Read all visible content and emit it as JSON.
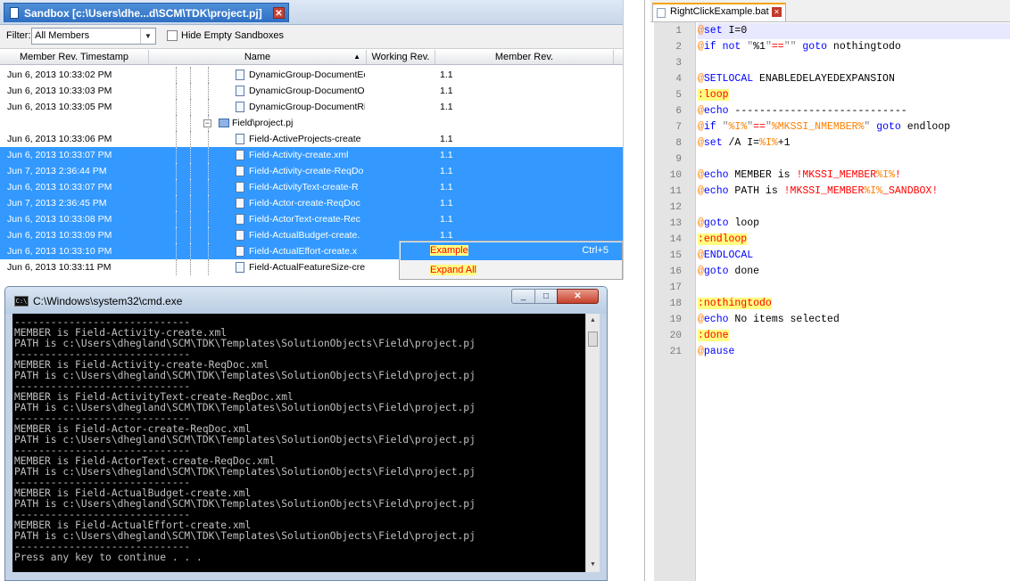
{
  "sandbox": {
    "title": "Sandbox [c:\\Users\\dhe...d\\SCM\\TDK\\project.pj]",
    "filter_label": "Filter:",
    "filter_value": "All Members",
    "hide_empty_label": "Hide Empty Sandboxes",
    "hide_empty_checked": false,
    "columns": {
      "timestamp": "Member Rev. Timestamp",
      "name": "Name",
      "working_rev": "Working Rev.",
      "member_rev": "Member Rev."
    },
    "rows": [
      {
        "ts": "Jun 6, 2013 10:33:02 PM",
        "name": "DynamicGroup-DocumentEc",
        "rev": "1.1",
        "selected": false
      },
      {
        "ts": "Jun 6, 2013 10:33:03 PM",
        "name": "DynamicGroup-DocumentO",
        "rev": "1.1",
        "selected": false
      },
      {
        "ts": "Jun 6, 2013 10:33:05 PM",
        "name": "DynamicGroup-DocumentRi",
        "rev": "1.1",
        "selected": false
      },
      {
        "ts": "",
        "name": "Field\\project.pj",
        "rev": "",
        "selected": false,
        "project": true
      },
      {
        "ts": "Jun 6, 2013 10:33:06 PM",
        "name": "Field-ActiveProjects-create",
        "rev": "1.1",
        "selected": false
      },
      {
        "ts": "Jun 6, 2013 10:33:07 PM",
        "name": "Field-Activity-create.xml",
        "rev": "1.1",
        "selected": true
      },
      {
        "ts": "Jun 7, 2013 2:36:44 PM",
        "name": "Field-Activity-create-ReqDo",
        "rev": "1.1",
        "selected": true
      },
      {
        "ts": "Jun 6, 2013 10:33:07 PM",
        "name": "Field-ActivityText-create-R",
        "rev": "1.1",
        "selected": true
      },
      {
        "ts": "Jun 7, 2013 2:36:45 PM",
        "name": "Field-Actor-create-ReqDoc",
        "rev": "1.1",
        "selected": true
      },
      {
        "ts": "Jun 6, 2013 10:33:08 PM",
        "name": "Field-ActorText-create-Rec",
        "rev": "1.1",
        "selected": true
      },
      {
        "ts": "Jun 6, 2013 10:33:09 PM",
        "name": "Field-ActualBudget-create.",
        "rev": "1.1",
        "selected": true
      },
      {
        "ts": "Jun 6, 2013 10:33:10 PM",
        "name": "Field-ActualEffort-create.x",
        "rev": "1.1",
        "selected": true
      },
      {
        "ts": "Jun 6, 2013 10:33:11 PM",
        "name": "Field-ActualFeatureSize-cre",
        "rev": "",
        "selected": false
      }
    ],
    "context_menu": {
      "items": [
        {
          "label": "Example",
          "shortcut": "Ctrl+5",
          "enabled": true
        },
        {
          "label": "Expand All",
          "shortcut": "",
          "enabled": false
        }
      ]
    }
  },
  "cmd": {
    "title": "C:\\Windows\\system32\\cmd.exe",
    "icon_text": "C:\\",
    "lines": [
      "-----------------------------",
      "MEMBER is Field-Activity-create.xml",
      "PATH is c:\\Users\\dhegland\\SCM\\TDK\\Templates\\SolutionObjects\\Field\\project.pj",
      "-----------------------------",
      "MEMBER is Field-Activity-create-ReqDoc.xml",
      "PATH is c:\\Users\\dhegland\\SCM\\TDK\\Templates\\SolutionObjects\\Field\\project.pj",
      "-----------------------------",
      "MEMBER is Field-ActivityText-create-ReqDoc.xml",
      "PATH is c:\\Users\\dhegland\\SCM\\TDK\\Templates\\SolutionObjects\\Field\\project.pj",
      "-----------------------------",
      "MEMBER is Field-Actor-create-ReqDoc.xml",
      "PATH is c:\\Users\\dhegland\\SCM\\TDK\\Templates\\SolutionObjects\\Field\\project.pj",
      "-----------------------------",
      "MEMBER is Field-ActorText-create-ReqDoc.xml",
      "PATH is c:\\Users\\dhegland\\SCM\\TDK\\Templates\\SolutionObjects\\Field\\project.pj",
      "-----------------------------",
      "MEMBER is Field-ActualBudget-create.xml",
      "PATH is c:\\Users\\dhegland\\SCM\\TDK\\Templates\\SolutionObjects\\Field\\project.pj",
      "-----------------------------",
      "MEMBER is Field-ActualEffort-create.xml",
      "PATH is c:\\Users\\dhegland\\SCM\\TDK\\Templates\\SolutionObjects\\Field\\project.pj",
      "-----------------------------",
      "Press any key to continue . . ."
    ]
  },
  "editor": {
    "tab_label": "RightClickExample.bat",
    "current_line": 1,
    "lines": [
      "@set I=0",
      "@if not \"%1\"==\"\" goto nothingtodo",
      "",
      "@SETLOCAL ENABLEDELAYEDEXPANSION",
      ":loop",
      "@echo ----------------------------",
      "@if \"%I%\"==\"%MKSSI_NMEMBER%\" goto endloop",
      "@set /A I=%I%+1",
      "",
      "@echo MEMBER is !MKSSI_MEMBER%I%!",
      "@echo PATH is !MKSSI_MEMBER%I%_SANDBOX!",
      "",
      "@goto loop",
      ":endloop",
      "@ENDLOCAL",
      "@goto done",
      "",
      ":nothingtodo",
      "@echo No items selected",
      ":done",
      "@pause"
    ]
  },
  "colors": {
    "selection": "#3399ff",
    "label_highlight": "#ffff80",
    "batch_at": "#ff8000",
    "batch_keyword": "#0000ff",
    "batch_label": "#ff0000"
  }
}
